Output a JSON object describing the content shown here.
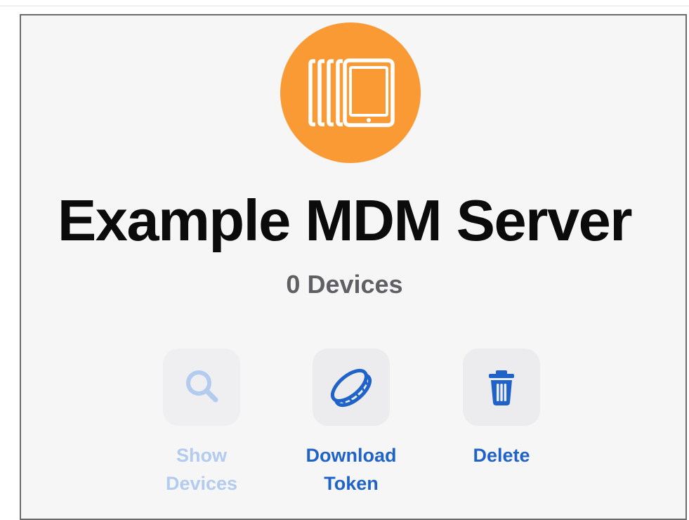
{
  "server": {
    "title": "Example MDM Server",
    "device_count": "0 Devices",
    "icon": "devices-stack-icon"
  },
  "actions": [
    {
      "label": "Show\nDevices",
      "icon": "search-icon",
      "enabled": false
    },
    {
      "label": "Download\nToken",
      "icon": "token-coin-icon",
      "enabled": true
    },
    {
      "label": "Delete",
      "icon": "trash-icon",
      "enabled": true
    }
  ],
  "colors": {
    "accent": "#1f63c9",
    "accent_disabled": "#b2cbee",
    "brand_orange": "#f99a35",
    "title_text": "#0b0b0b",
    "secondary_text": "#5f5f64"
  }
}
